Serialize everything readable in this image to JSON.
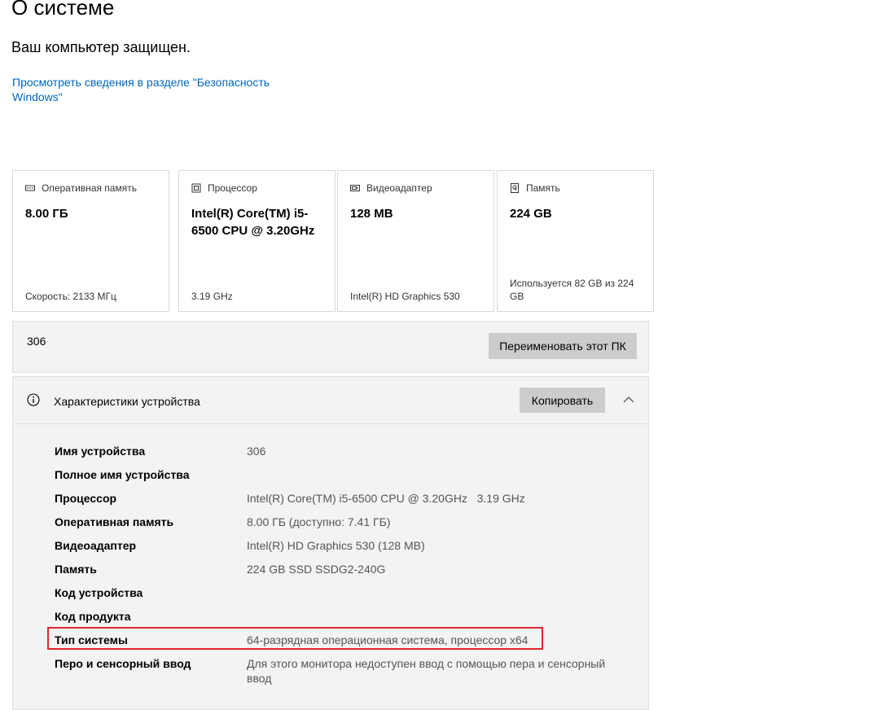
{
  "page": {
    "title": "О системе",
    "protection_status": "Ваш компьютер защищен.",
    "security_link": "Просмотреть сведения в разделе \"Безопасность Windows\""
  },
  "cards": [
    {
      "icon": "ram-icon",
      "label": "Оперативная память",
      "value": "8.00 ГБ",
      "footer": "Скорость: 2133 МГц"
    },
    {
      "icon": "processor-icon",
      "label": "Процессор",
      "value": "Intel(R) Core(TM) i5-6500 CPU @ 3.20GHz",
      "footer": "3.19 GHz"
    },
    {
      "icon": "video-adapter-icon",
      "label": "Видеоадаптер",
      "value": "128 MB",
      "footer": "Intel(R) HD Graphics 530"
    },
    {
      "icon": "storage-icon",
      "label": "Память",
      "value": "224 GB",
      "footer": "Используется 82 GB из 224 GB"
    }
  ],
  "rename": {
    "pc_name": "306",
    "button_label": "Переименовать этот ПК"
  },
  "specs": {
    "title": "Характеристики устройства",
    "copy_label": "Копировать",
    "rows": [
      {
        "label": "Имя устройства",
        "value": "306"
      },
      {
        "label": "Полное имя устройства",
        "value": ""
      },
      {
        "label": "Процессор",
        "value": "Intel(R) Core(TM) i5-6500 CPU @ 3.20GHz   3.19 GHz"
      },
      {
        "label": "Оперативная память",
        "value": "8.00 ГБ (доступно: 7.41 ГБ)"
      },
      {
        "label": "Видеоадаптер",
        "value": "Intel(R) HD Graphics 530 (128 MB)"
      },
      {
        "label": "Память",
        "value": "224 GB SSD SSDG2-240G"
      },
      {
        "label": "Код устройства",
        "value": ""
      },
      {
        "label": "Код продукта",
        "value": ""
      },
      {
        "label": "Тип системы",
        "value": "64-разрядная операционная система, процессор x64"
      },
      {
        "label": "Перо и сенсорный ввод",
        "value": "Для этого монитора недоступен ввод с помощью пера и сенсорный ввод"
      }
    ]
  },
  "colors": {
    "link": "#0067c0",
    "highlight": "#e0242c",
    "button": "#cccccc",
    "panel": "#f3f3f3"
  }
}
